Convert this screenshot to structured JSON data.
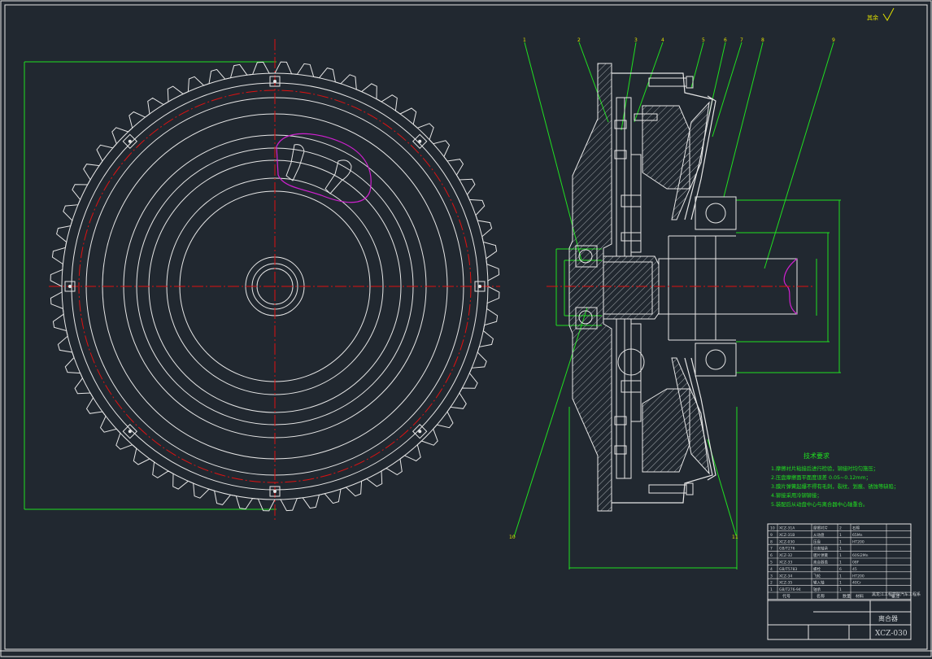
{
  "drawing": {
    "background": "#212830",
    "line_color": "#e6e6e6",
    "center_line_color": "#e01010",
    "dimension_color": "#20e020",
    "highlight_color": "#d020d0",
    "roughness_symbol": "其余",
    "balloons": [
      "1",
      "2",
      "3",
      "4",
      "5",
      "6",
      "7",
      "8",
      "9",
      "10",
      "11"
    ],
    "technical_requirements": {
      "title": "技术要求",
      "items": [
        "1.摩擦衬片粘接后进行检验，铆接时均匀施压；",
        "2.压盘摩擦面平面度误差 0.05~0.12mm；",
        "3.膜片弹簧起爆不得有毛刺，裂纹、划痕、锈蚀等缺陷；",
        "4.铆接采用冷铆铆接；",
        "5.装配后从动盘中心与离合器中心轴重合。"
      ]
    },
    "title_block": {
      "title": "离合器",
      "drawing_number": "XCZ-030",
      "institution": "黑龙江工程学院汽车工程系",
      "header_labels": [
        "代号",
        "名称",
        "数量",
        "材料",
        "备注"
      ],
      "parts": [
        [
          "XCZ-31A",
          "摩擦衬片",
          "2",
          "石棉",
          ""
        ],
        [
          "XCZ-31B",
          "从动盘",
          "1",
          "65Mn",
          ""
        ],
        [
          "XCZ-030",
          "压盘",
          "1",
          "HT200",
          ""
        ],
        [
          "GB/T276",
          "分离轴承",
          "1",
          "",
          ""
        ],
        [
          "XCZ-32",
          "膜片弹簧",
          "1",
          "60Si2Mn",
          ""
        ],
        [
          "XCZ-33",
          "离合器盖",
          "1",
          "08F",
          ""
        ],
        [
          "GB/T5783",
          "螺栓",
          "6",
          "45",
          ""
        ],
        [
          "XCZ-34",
          "飞轮",
          "1",
          "HT200",
          ""
        ],
        [
          "XCZ-35",
          "输入轴",
          "1",
          "40Cr",
          ""
        ],
        [
          "GB/T276-94",
          "轴承",
          "1",
          "",
          ""
        ]
      ]
    }
  }
}
